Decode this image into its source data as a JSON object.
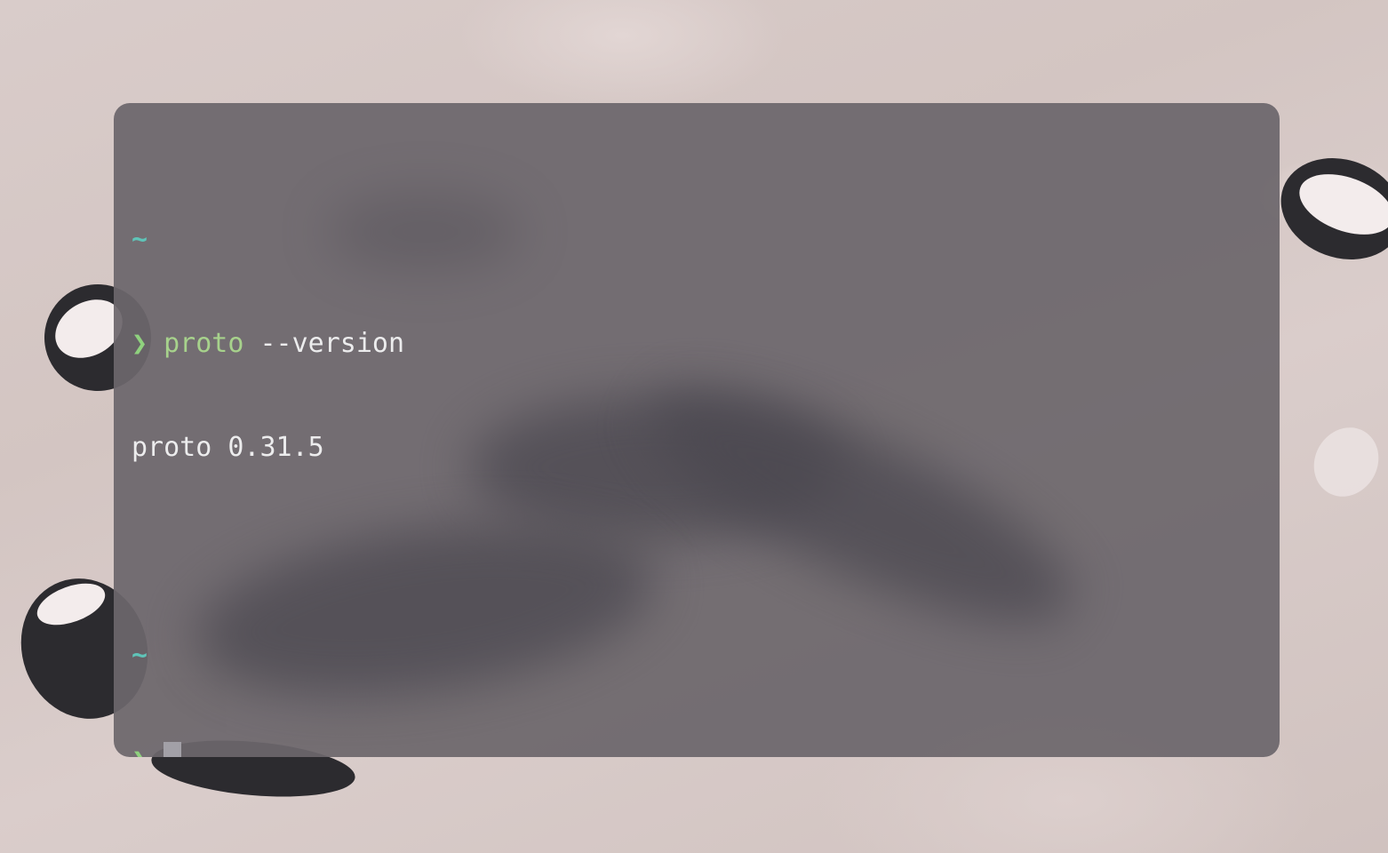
{
  "terminal": {
    "blocks": [
      {
        "cwd": "~",
        "prompt_symbol": "❯",
        "command": "proto",
        "args": "--version",
        "output": "proto 0.31.5"
      },
      {
        "cwd": "~",
        "prompt_symbol": "❯",
        "command": "",
        "args": ""
      }
    ]
  },
  "colors": {
    "cwd": "#5fc4b8",
    "prompt": "#8fd17e",
    "command": "#a7d28c",
    "text": "#ececed",
    "cursor": "#a2a0a7"
  }
}
